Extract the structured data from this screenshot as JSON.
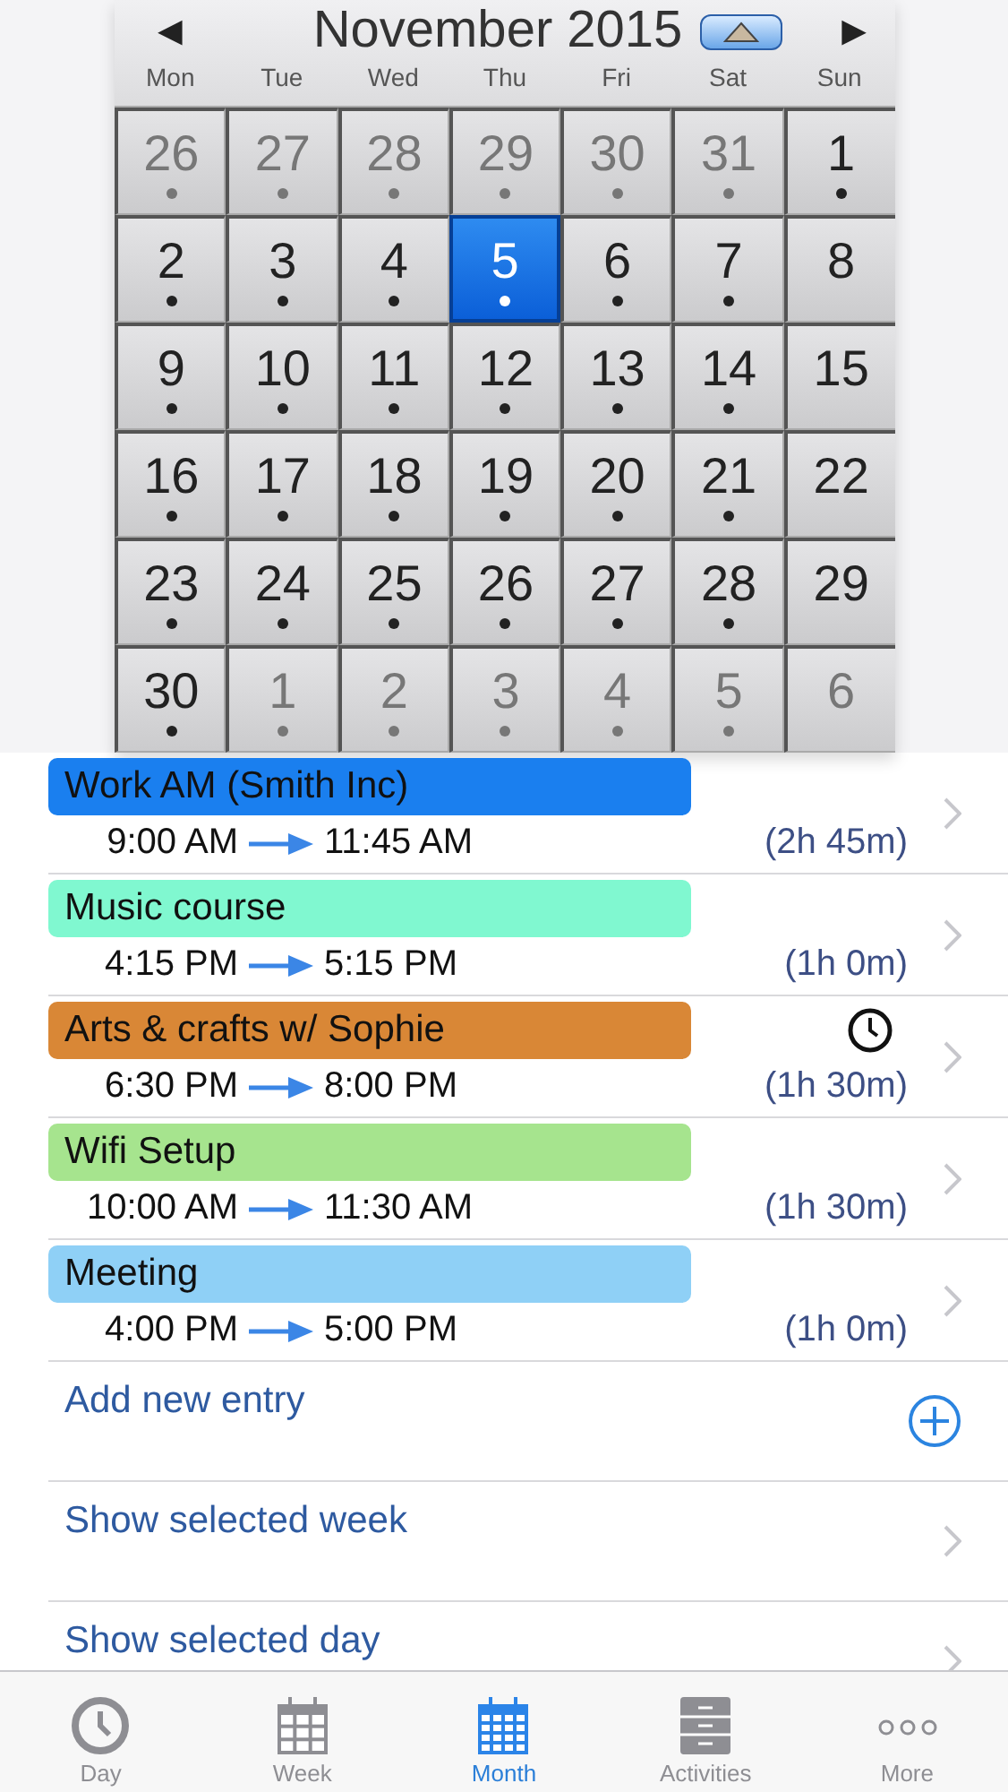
{
  "calendar": {
    "prev": "◀",
    "title": "November 2015",
    "next": "▶",
    "weekdays": [
      "Mon",
      "Tue",
      "Wed",
      "Thu",
      "Fri",
      "Sat",
      "Sun"
    ],
    "weeks": [
      [
        {
          "day": "26",
          "in_month": false,
          "has_entry": true,
          "selected": false
        },
        {
          "day": "27",
          "in_month": false,
          "has_entry": true,
          "selected": false
        },
        {
          "day": "28",
          "in_month": false,
          "has_entry": true,
          "selected": false
        },
        {
          "day": "29",
          "in_month": false,
          "has_entry": true,
          "selected": false
        },
        {
          "day": "30",
          "in_month": false,
          "has_entry": true,
          "selected": false
        },
        {
          "day": "31",
          "in_month": false,
          "has_entry": true,
          "selected": false
        },
        {
          "day": "1",
          "in_month": true,
          "has_entry": true,
          "selected": false
        }
      ],
      [
        {
          "day": "2",
          "in_month": true,
          "has_entry": true,
          "selected": false
        },
        {
          "day": "3",
          "in_month": true,
          "has_entry": true,
          "selected": false
        },
        {
          "day": "4",
          "in_month": true,
          "has_entry": true,
          "selected": false
        },
        {
          "day": "5",
          "in_month": true,
          "has_entry": true,
          "selected": true
        },
        {
          "day": "6",
          "in_month": true,
          "has_entry": true,
          "selected": false
        },
        {
          "day": "7",
          "in_month": true,
          "has_entry": true,
          "selected": false
        },
        {
          "day": "8",
          "in_month": true,
          "has_entry": false,
          "selected": false
        }
      ],
      [
        {
          "day": "9",
          "in_month": true,
          "has_entry": true,
          "selected": false
        },
        {
          "day": "10",
          "in_month": true,
          "has_entry": true,
          "selected": false
        },
        {
          "day": "11",
          "in_month": true,
          "has_entry": true,
          "selected": false
        },
        {
          "day": "12",
          "in_month": true,
          "has_entry": true,
          "selected": false
        },
        {
          "day": "13",
          "in_month": true,
          "has_entry": true,
          "selected": false
        },
        {
          "day": "14",
          "in_month": true,
          "has_entry": true,
          "selected": false
        },
        {
          "day": "15",
          "in_month": true,
          "has_entry": false,
          "selected": false
        }
      ],
      [
        {
          "day": "16",
          "in_month": true,
          "has_entry": true,
          "selected": false
        },
        {
          "day": "17",
          "in_month": true,
          "has_entry": true,
          "selected": false
        },
        {
          "day": "18",
          "in_month": true,
          "has_entry": true,
          "selected": false
        },
        {
          "day": "19",
          "in_month": true,
          "has_entry": true,
          "selected": false
        },
        {
          "day": "20",
          "in_month": true,
          "has_entry": true,
          "selected": false
        },
        {
          "day": "21",
          "in_month": true,
          "has_entry": true,
          "selected": false
        },
        {
          "day": "22",
          "in_month": true,
          "has_entry": false,
          "selected": false
        }
      ],
      [
        {
          "day": "23",
          "in_month": true,
          "has_entry": true,
          "selected": false
        },
        {
          "day": "24",
          "in_month": true,
          "has_entry": true,
          "selected": false
        },
        {
          "day": "25",
          "in_month": true,
          "has_entry": true,
          "selected": false
        },
        {
          "day": "26",
          "in_month": true,
          "has_entry": true,
          "selected": false
        },
        {
          "day": "27",
          "in_month": true,
          "has_entry": true,
          "selected": false
        },
        {
          "day": "28",
          "in_month": true,
          "has_entry": true,
          "selected": false
        },
        {
          "day": "29",
          "in_month": true,
          "has_entry": false,
          "selected": false
        }
      ],
      [
        {
          "day": "30",
          "in_month": true,
          "has_entry": true,
          "selected": false
        },
        {
          "day": "1",
          "in_month": false,
          "has_entry": true,
          "selected": false
        },
        {
          "day": "2",
          "in_month": false,
          "has_entry": true,
          "selected": false
        },
        {
          "day": "3",
          "in_month": false,
          "has_entry": true,
          "selected": false
        },
        {
          "day": "4",
          "in_month": false,
          "has_entry": true,
          "selected": false
        },
        {
          "day": "5",
          "in_month": false,
          "has_entry": true,
          "selected": false
        },
        {
          "day": "6",
          "in_month": false,
          "has_entry": false,
          "selected": false
        }
      ]
    ]
  },
  "entries": [
    {
      "title": "Work AM (Smith Inc)",
      "color": "#1a7fef",
      "start": "9:00 AM",
      "end": "11:45 AM",
      "duration": "(2h 45m)",
      "alarm": false
    },
    {
      "title": "Music course",
      "color": "#80f8d0",
      "start": "4:15 PM",
      "end": "5:15 PM",
      "duration": "(1h 0m)",
      "alarm": false
    },
    {
      "title": "Arts & crafts w/ Sophie",
      "color": "#d98736",
      "start": "6:30 PM",
      "end": "8:00 PM",
      "duration": "(1h 30m)",
      "alarm": true
    },
    {
      "title": "Wifi Setup",
      "color": "#a6e48e",
      "start": "10:00 AM",
      "end": "11:30 AM",
      "duration": "(1h 30m)",
      "alarm": false
    },
    {
      "title": "Meeting",
      "color": "#8fd0f6",
      "start": "4:00 PM",
      "end": "5:00 PM",
      "duration": "(1h 0m)",
      "alarm": false
    }
  ],
  "actions": [
    {
      "label": "Add new entry",
      "kind": "add"
    },
    {
      "label": "Show selected week",
      "kind": "link"
    },
    {
      "label": "Show selected day",
      "kind": "link"
    }
  ],
  "tabs": [
    {
      "label": "Day",
      "kind": "clock",
      "selected": false
    },
    {
      "label": "Week",
      "kind": "week",
      "selected": false
    },
    {
      "label": "Month",
      "kind": "month",
      "selected": true
    },
    {
      "label": "Activities",
      "kind": "cabinet",
      "selected": false
    },
    {
      "label": "More",
      "kind": "more",
      "selected": false
    }
  ]
}
